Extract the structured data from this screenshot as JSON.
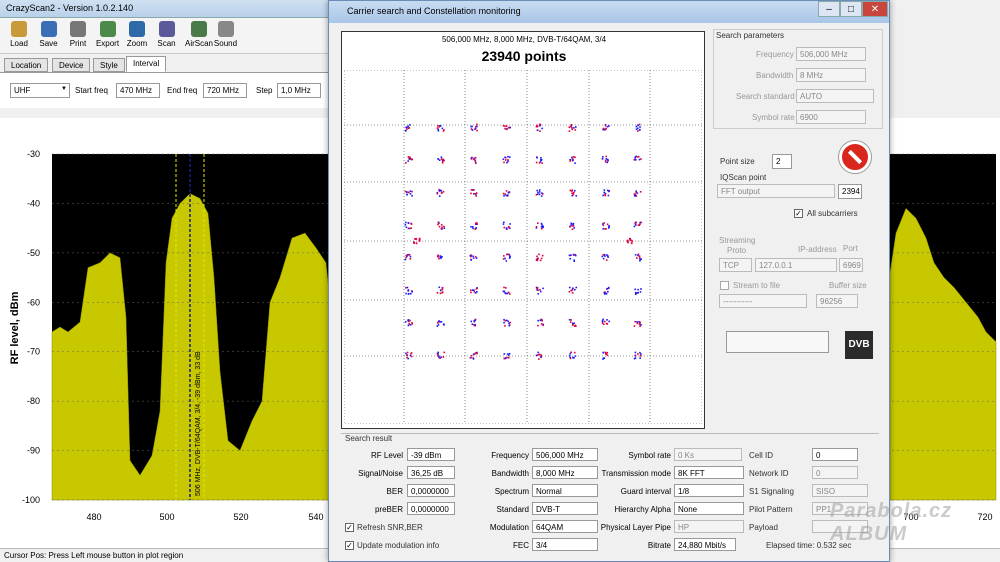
{
  "app": {
    "title": "CrazyScan2 - Version 1.0.2.140",
    "toolbar": [
      {
        "label": "Load",
        "icon": "folder-open-icon"
      },
      {
        "label": "Save",
        "icon": "floppy-icon"
      },
      {
        "label": "Print",
        "icon": "printer-icon"
      },
      {
        "label": "Export",
        "icon": "export-icon"
      },
      {
        "label": "Zoom",
        "icon": "zoom-icon"
      },
      {
        "label": "Scan",
        "icon": "scan-icon"
      },
      {
        "label": "AirScan",
        "icon": "satellite-icon"
      },
      {
        "label": "Sound",
        "icon": "speaker-icon"
      }
    ],
    "tabs": [
      "Location",
      "Device",
      "Style",
      "Interval"
    ],
    "interval": {
      "band": "UHF",
      "start_label": "Start freq",
      "start": "470 MHz",
      "end_label": "End freq",
      "end": "720 MHz",
      "step_label": "Step",
      "step": "1,0 MHz"
    },
    "status": "Cursor Pos: Press Left mouse button in plot region"
  },
  "spectrum": {
    "ylabel": "RF level, dBm",
    "yticks": [
      "-30",
      "-40",
      "-50",
      "-60",
      "-70",
      "-80",
      "-90",
      "-100"
    ],
    "xticks": [
      "480",
      "500",
      "520",
      "540",
      "700",
      "720"
    ],
    "marker": "506 MHz, DVB-T/64QAM, 3/4, -39 dBm, 33 dB"
  },
  "dialog": {
    "title": "Carrier search and Constellation monitoring",
    "const_sub": "506,000 MHz, 8,000 MHz, DVB-T/64QAM, 3/4",
    "const_head": "23940 points",
    "search_params": {
      "title": "Search parameters",
      "frequency_label": "Frequency",
      "frequency": "506,000 MHz",
      "bandwidth_label": "Bandwidth",
      "bandwidth": "8 MHz",
      "standard_label": "Search standard",
      "standard": "AUTO",
      "symrate_label": "Symbol rate",
      "symrate": "6900"
    },
    "point_size_label": "Point size",
    "point_size": "2",
    "iqscan_label": "IQScan point",
    "iqscan": "FFT output",
    "iqscan_value": "2394",
    "all_sub": "All subcarriers",
    "streaming": {
      "title": "Streaming",
      "proto_label": "Proto",
      "proto": "TCP",
      "ip_label": "IP-address",
      "ip": "127.0.0.1",
      "port_label": "Port",
      "port": "6969",
      "stream_file": "Stream to file",
      "buffer_label": "Buffer size",
      "file": "-----------",
      "buffer": "96256"
    },
    "dvb_logo": "DVB",
    "search_result": {
      "title": "Search result",
      "rf_label": "RF Level",
      "rf": "-39 dBm",
      "sn_label": "Signal/Noise",
      "sn": "36,25 dB",
      "ber_label": "BER",
      "ber": "0,0000000",
      "preber_label": "preBER",
      "preber": "0,0000000",
      "refresh": "Refresh SNR,BER",
      "update": "Update modulation info",
      "freq_label": "Frequency",
      "freq": "506,000 MHz",
      "bw_label": "Bandwidth",
      "bw": "8,000 MHz",
      "spectrum_label": "Spectrum",
      "spectrum": "Normal",
      "std_label": "Standard",
      "std": "DVB-T",
      "mod_label": "Modulation",
      "mod": "64QAM",
      "fec_label": "FEC",
      "fec": "3/4",
      "sr_label": "Symbol rate",
      "sr": "0 Ks",
      "tm_label": "Transmission mode",
      "tm": "8K FFT",
      "gi_label": "Guard interval",
      "gi": "1/8",
      "ha_label": "Hierarchy Alpha",
      "ha": "None",
      "plp_label": "Physical Layer Pipe",
      "plp": "HP",
      "bitrate_label": "Bitrate",
      "bitrate": "24,880 Mbit/s",
      "cell_label": "Cell ID",
      "cell": "0",
      "net_label": "Network ID",
      "net": "0",
      "s1_label": "S1 Signaling",
      "s1": "SISO",
      "pp_label": "Pilot Pattern",
      "pp": "PP1",
      "payload_label": "Payload",
      "payload": "",
      "elapsed": "Elapsed time: 0.532 sec"
    }
  },
  "watermark": "Parabola.cz ALBUM",
  "colors": {
    "spectrum_fill": "#c8c800",
    "plot_bg": "#000000",
    "dots_blue": "#1a1aff",
    "dots_red": "#e0003a"
  }
}
